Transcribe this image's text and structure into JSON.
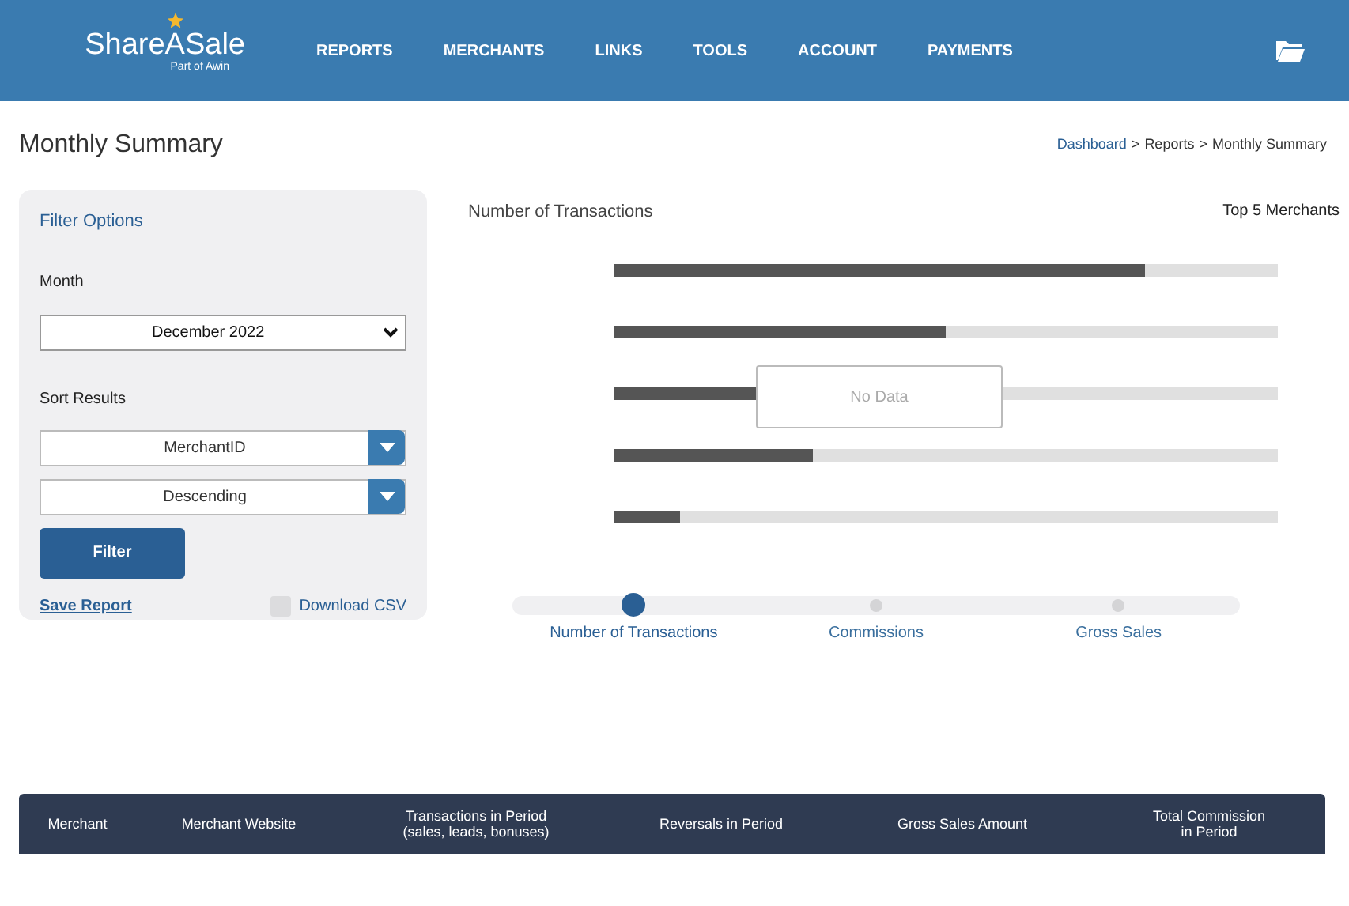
{
  "header": {
    "logo": "ShareASale",
    "logo_sub": "Part of Awin",
    "nav": [
      "REPORTS",
      "MERCHANTS",
      "LINKS",
      "TOOLS",
      "ACCOUNT",
      "PAYMENTS"
    ]
  },
  "page": {
    "title": "Monthly Summary",
    "breadcrumb": [
      {
        "label": "Dashboard",
        "link": true
      },
      {
        "label": ">",
        "link": false
      },
      {
        "label": "Reports",
        "link": false
      },
      {
        "label": ">",
        "link": false
      },
      {
        "label": "Monthly Summary",
        "link": false
      }
    ]
  },
  "filter": {
    "title": "Filter Options",
    "month_label": "Month",
    "month": "December 2022",
    "sort_label": "Sort Results",
    "sort_by": "MerchantID",
    "order": "Descending",
    "button": "Filter",
    "save": "Save Report",
    "csv": {
      "label": "Download CSV",
      "checked": false
    }
  },
  "chart": {
    "title": "Number of Transactions",
    "subtitle": "Top 5 Merchants",
    "message": "No Data"
  },
  "steps": [
    {
      "label": "Number of Transactions",
      "selected": true
    },
    {
      "label": "Commissions",
      "selected": false
    },
    {
      "label": "Gross Sales",
      "selected": false
    }
  ],
  "table": {
    "columns": [
      "Merchant",
      "Merchant Website",
      "Transactions in Period\n(sales, leads, bonuses)",
      "Reversals in Period",
      "Gross Sales Amount",
      "Total Commission\nin Period"
    ]
  }
}
